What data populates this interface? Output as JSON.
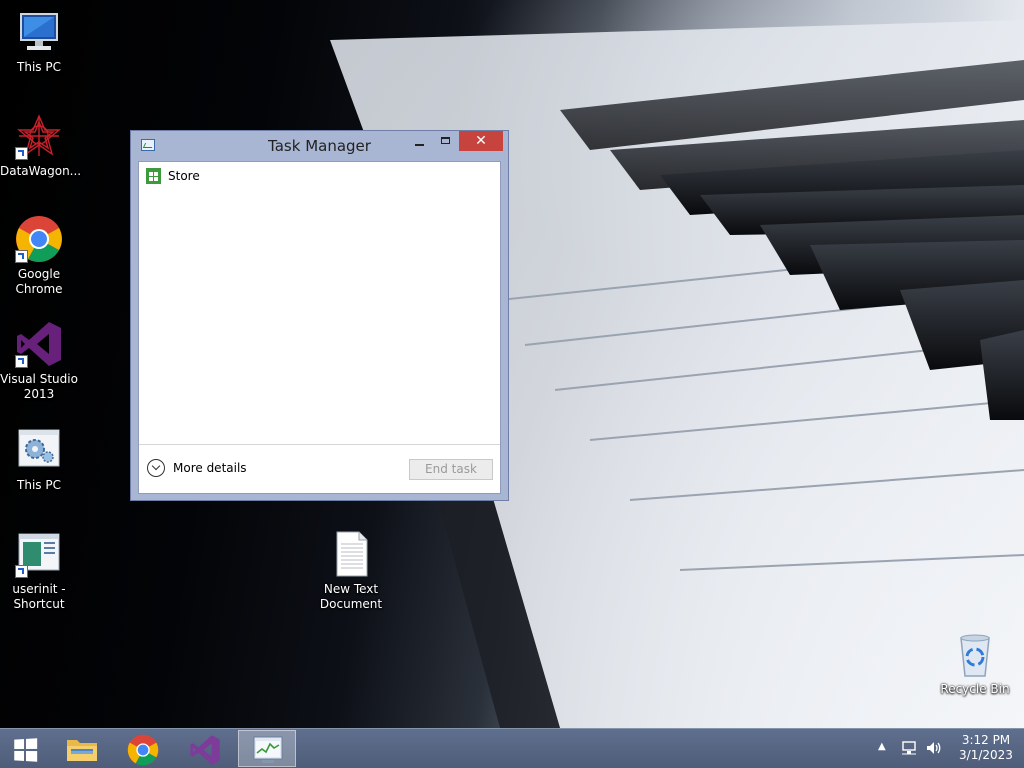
{
  "desktop": {
    "icons": [
      {
        "label": "This PC",
        "icon": "computer-icon"
      },
      {
        "label": "DataWagon...",
        "icon": "datawagon-icon",
        "shortcut": true
      },
      {
        "label": "Google\nChrome",
        "icon": "chrome-icon",
        "shortcut": true
      },
      {
        "label": "Visual Studio\n2013",
        "icon": "visual-studio-icon",
        "shortcut": true
      },
      {
        "label": "This PC",
        "icon": "settings-gear-icon"
      },
      {
        "label": "userinit -\nShortcut",
        "icon": "userinit-icon",
        "shortcut": true
      },
      {
        "label": "New Text\nDocument",
        "icon": "text-document-icon"
      },
      {
        "label": "Recycle Bin",
        "icon": "recycle-bin-icon"
      }
    ]
  },
  "task_manager": {
    "title": "Task Manager",
    "close_glyph": "✕",
    "apps": [
      {
        "name": "Store",
        "icon": "store-icon"
      }
    ],
    "more_details_label": "More details",
    "end_task_label": "End task",
    "end_task_enabled": false
  },
  "taskbar": {
    "pinned": [
      {
        "name": "start",
        "icon": "windows-logo-icon"
      },
      {
        "name": "file-explorer",
        "icon": "folder-icon"
      },
      {
        "name": "google-chrome",
        "icon": "chrome-icon"
      },
      {
        "name": "visual-studio",
        "icon": "visual-studio-icon"
      },
      {
        "name": "task-manager",
        "icon": "task-manager-icon",
        "active": true
      }
    ],
    "tray": {
      "chevron": "▲",
      "time": "3:12 PM",
      "date": "3/1/2023"
    }
  },
  "colors": {
    "close_button": "#c7443e",
    "window_frame": "#a9b6d3",
    "taskbar": "#56657f",
    "store_green": "#3c9a3c",
    "vs_purple": "#68217a"
  }
}
